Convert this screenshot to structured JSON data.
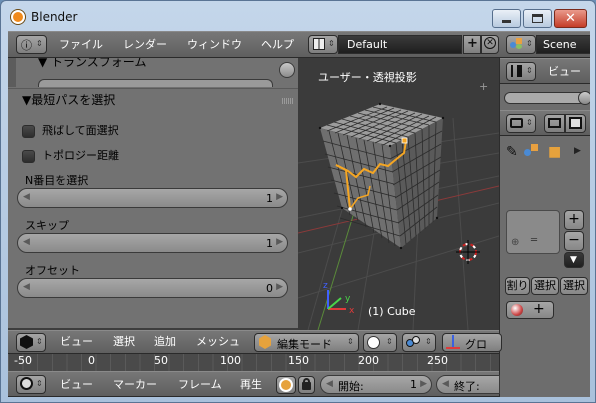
{
  "window": {
    "title": "Blender",
    "close_glyph": "✕"
  },
  "info_header": {
    "menus": [
      "ファイル",
      "レンダー",
      "ウィンドウ",
      "ヘルプ"
    ],
    "screen_layout": "Default",
    "scene": "Scene"
  },
  "tool_panel": {
    "collapsed_header": "▼ トランスフォーム",
    "section_title": "▼最短パスを選択",
    "checkboxes": [
      "飛ばして面選択",
      "トポロジー距離"
    ],
    "fields": [
      {
        "label": "N番目を選択",
        "value": "1"
      },
      {
        "label": "スキップ",
        "value": "1"
      },
      {
        "label": "オフセット",
        "value": "0"
      }
    ]
  },
  "viewport": {
    "view_label": "ユーザー・透視投影",
    "object_label": "(1) Cube",
    "axis_x": "x",
    "axis_y": "y",
    "axis_z": "z"
  },
  "viewport_header": {
    "menus": [
      "ビュー",
      "選択",
      "追加",
      "メッシュ"
    ],
    "mode": "編集モード",
    "pivot_partial": "グロ"
  },
  "timeline": {
    "ticks": [
      "-50",
      "0",
      "50",
      "100",
      "150",
      "200",
      "250"
    ]
  },
  "timeline_header": {
    "menus": [
      "ビュー",
      "マーカー",
      "フレーム",
      "再生"
    ],
    "start_label": "開始:",
    "start_value": "1",
    "end_label": "終了:"
  },
  "right_panel": {
    "outliner_view": "ビュー",
    "buttons": [
      "割り",
      "選択",
      "選択"
    ]
  },
  "colors": {
    "selection_orange": "#f5a623",
    "active_vertex": "#ffffff",
    "panel_gray": "#727272",
    "header_gray": "#6a6a6a"
  }
}
